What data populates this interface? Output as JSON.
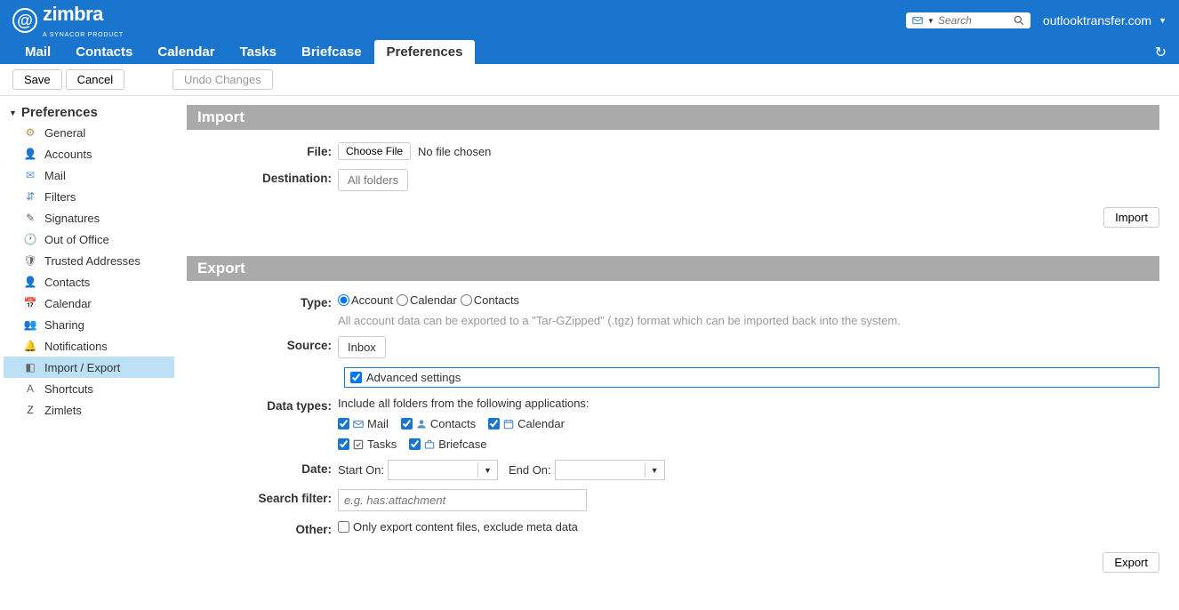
{
  "header": {
    "brand": "zimbra",
    "brand_sub": "A SYNACOR PRODUCT",
    "search_placeholder": "Search",
    "user": "outlooktransfer.com"
  },
  "nav": {
    "tabs": [
      "Mail",
      "Contacts",
      "Calendar",
      "Tasks",
      "Briefcase",
      "Preferences"
    ],
    "active": "Preferences"
  },
  "toolbar": {
    "save_label": "Save",
    "cancel_label": "Cancel",
    "undo_label": "Undo Changes"
  },
  "sidebar": {
    "header": "Preferences",
    "items": [
      {
        "label": "General",
        "icon": "⚙",
        "color": "#b89050"
      },
      {
        "label": "Accounts",
        "icon": "👤",
        "color": "#e07040"
      },
      {
        "label": "Mail",
        "icon": "✉",
        "color": "#5a8fc8"
      },
      {
        "label": "Filters",
        "icon": "⇵",
        "color": "#5a8fc8"
      },
      {
        "label": "Signatures",
        "icon": "✎",
        "color": "#666"
      },
      {
        "label": "Out of Office",
        "icon": "🕐",
        "color": "#b8504a"
      },
      {
        "label": "Trusted Addresses",
        "icon": "🛡",
        "color": "#666"
      },
      {
        "label": "Contacts",
        "icon": "👤",
        "color": "#5a8fc8"
      },
      {
        "label": "Calendar",
        "icon": "📅",
        "color": "#5a8fc8"
      },
      {
        "label": "Sharing",
        "icon": "👥",
        "color": "#5a8fc8"
      },
      {
        "label": "Notifications",
        "icon": "🔔",
        "color": "#d4a040"
      },
      {
        "label": "Import / Export",
        "icon": "◧",
        "color": "#666",
        "selected": true
      },
      {
        "label": "Shortcuts",
        "icon": "A",
        "color": "#666"
      },
      {
        "label": "Zimlets",
        "icon": "Z",
        "color": "#444"
      }
    ]
  },
  "import_section": {
    "header": "Import",
    "file_label": "File:",
    "choose_file_btn": "Choose File",
    "no_file_text": "No file chosen",
    "destination_label": "Destination:",
    "destination_value": "All folders",
    "import_btn": "Import"
  },
  "export_section": {
    "header": "Export",
    "type_label": "Type:",
    "type_options": [
      "Account",
      "Calendar",
      "Contacts"
    ],
    "type_selected": "Account",
    "type_hint": "All account data can be exported to a \"Tar-GZipped\" (.tgz) format which can be imported back into the system.",
    "source_label": "Source:",
    "source_value": "Inbox",
    "advanced_label": "Advanced settings",
    "advanced_checked": true,
    "datatypes_label": "Data types:",
    "datatypes_hint": "Include all folders from the following applications:",
    "datatypes": [
      {
        "label": "Mail",
        "checked": true
      },
      {
        "label": "Contacts",
        "checked": true
      },
      {
        "label": "Calendar",
        "checked": true
      },
      {
        "label": "Tasks",
        "checked": true
      },
      {
        "label": "Briefcase",
        "checked": true
      }
    ],
    "date_label": "Date:",
    "start_on": "Start On:",
    "end_on": "End On:",
    "searchfilter_label": "Search filter:",
    "searchfilter_placeholder": "e.g. has:attachment",
    "other_label": "Other:",
    "other_checkbox": "Only export content files, exclude meta data",
    "export_btn": "Export"
  }
}
